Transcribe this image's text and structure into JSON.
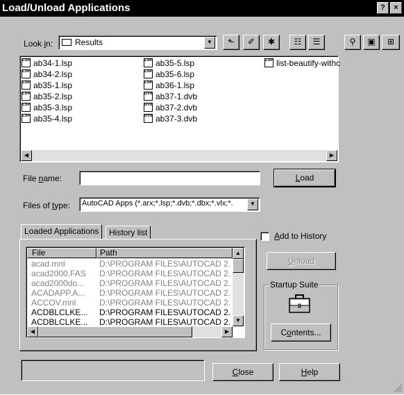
{
  "window": {
    "title": "Load/Unload Applications",
    "help_glyph": "?",
    "close_glyph": "×"
  },
  "lookin": {
    "label_pre": "Look ",
    "label_key": "i",
    "label_post": "n:",
    "value": "Results"
  },
  "files": [
    {
      "name": "ab34-1.lsp",
      "kind": "LSP"
    },
    {
      "name": "ab34-2.lsp",
      "kind": "LSP"
    },
    {
      "name": "ab35-1.lsp",
      "kind": "LSP"
    },
    {
      "name": "ab35-2.lsp",
      "kind": "LSP"
    },
    {
      "name": "ab35-3.lsp",
      "kind": "LSP"
    },
    {
      "name": "ab35-4.lsp",
      "kind": "LSP"
    },
    {
      "name": "ab35-5.lsp",
      "kind": "LSP"
    },
    {
      "name": "ab35-6.lsp",
      "kind": "LSP"
    },
    {
      "name": "ab36-1.lsp",
      "kind": "LSP"
    },
    {
      "name": "ab37-1.dvb",
      "kind": "DVB"
    },
    {
      "name": "ab37-2.dvb",
      "kind": "DVB"
    },
    {
      "name": "ab37-3.dvb",
      "kind": "DVB"
    },
    {
      "name": "list-beautify-withc",
      "kind": "LSP"
    }
  ],
  "filename": {
    "label_pre": "File ",
    "label_key": "n",
    "label_post": "ame:",
    "value": ""
  },
  "filetype": {
    "label_pre": "Files of ",
    "label_key": "t",
    "label_post": "ype:",
    "value": "AutoCAD Apps (*.arx;*.lsp;*.dvb;*.dbx;*.vlx;*."
  },
  "buttons": {
    "load_pre": "",
    "load_key": "L",
    "load_post": "oad",
    "unload_pre": "",
    "unload_key": "U",
    "unload_post": "nload",
    "contents_pre": "C",
    "contents_key": "o",
    "contents_post": "ntents...",
    "close_pre": "",
    "close_key": "C",
    "close_post": "lose",
    "help_pre": "",
    "help_key": "H",
    "help_post": "elp"
  },
  "tabs": [
    "Loaded Applications",
    "History list"
  ],
  "add_history": {
    "label_pre": "",
    "label_key": "A",
    "label_post": "dd to History",
    "checked": false
  },
  "loaded_table": {
    "headers": [
      "File",
      "Path"
    ],
    "rows": [
      {
        "file": "acad.mnl",
        "path": "D:\\PROGRAM FILES\\AUTOCAD 2.",
        "grey": true
      },
      {
        "file": "acad2000.FAS",
        "path": "D:\\PROGRAM FILES\\AUTOCAD 2.",
        "grey": true
      },
      {
        "file": "acad2000do...",
        "path": "D:\\PROGRAM FILES\\AUTOCAD 2.",
        "grey": true
      },
      {
        "file": "ACADAPP.A...",
        "path": "D:\\PROGRAM FILES\\AUTOCAD 2.",
        "grey": true
      },
      {
        "file": "ACCOV.mnl",
        "path": "D:\\PROGRAM FILES\\AUTOCAD 2.",
        "grey": true
      },
      {
        "file": "ACDBLCLKE...",
        "path": "D:\\PROGRAM FILES\\AUTOCAD 2.",
        "grey": false
      },
      {
        "file": "ACDBLCLKE...",
        "path": "D:\\PROGRAM FILES\\AUTOCAD 2.",
        "grey": false
      }
    ]
  },
  "startup_suite": {
    "title": "Startup Suite"
  },
  "status_text": ""
}
